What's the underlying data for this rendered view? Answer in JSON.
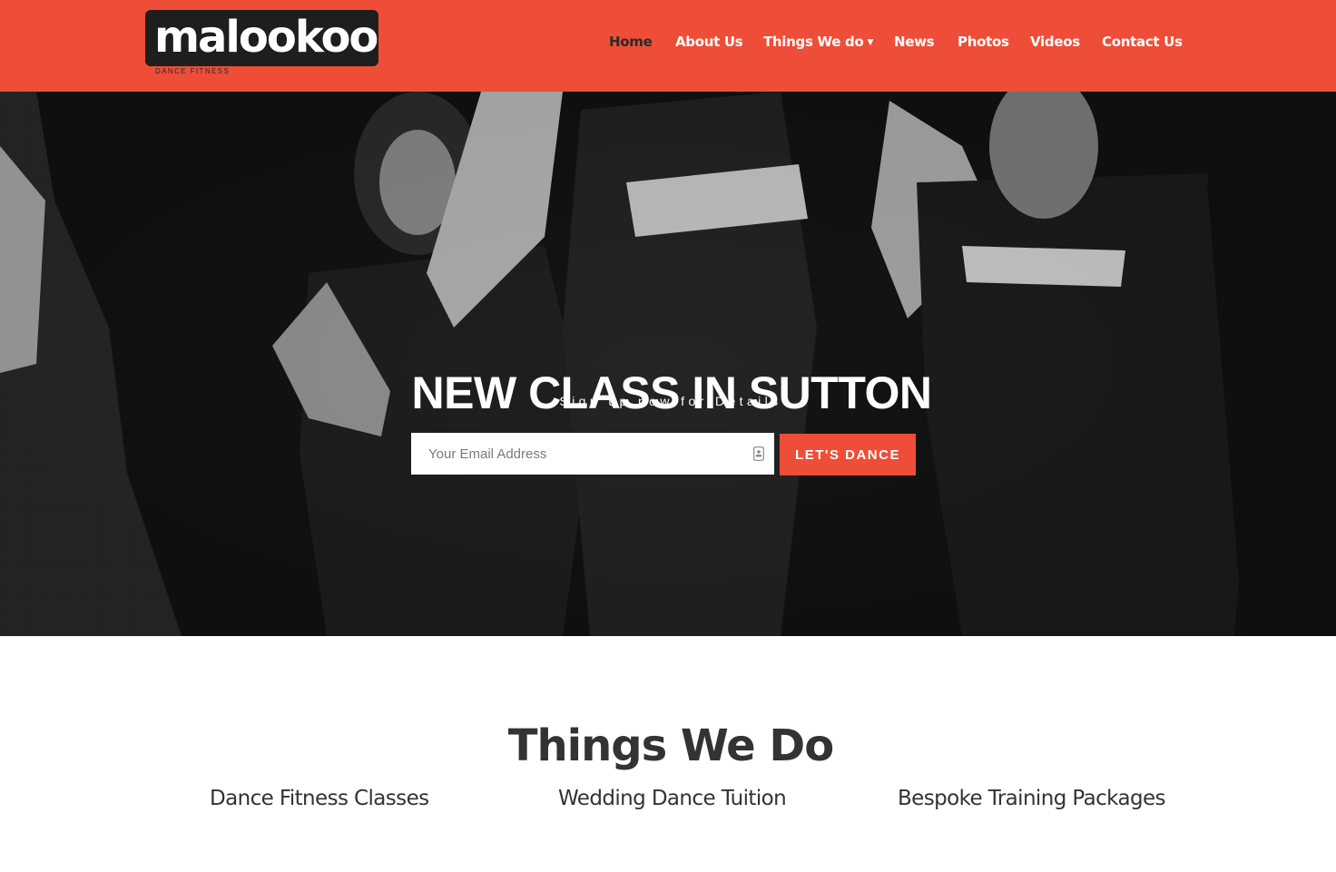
{
  "brand": {
    "logo_text": "malookoo",
    "tagline": "DANCE FITNESS"
  },
  "nav": {
    "items": [
      {
        "label": "Home",
        "active": true
      },
      {
        "label": "About Us"
      },
      {
        "label": "Things We do",
        "has_dropdown": true
      },
      {
        "label": "News"
      },
      {
        "label": "Photos"
      },
      {
        "label": "Videos"
      },
      {
        "label": "Contact Us"
      }
    ]
  },
  "hero": {
    "title": "NEW CLASS IN SUTTON",
    "subtitle": "Sign up now for Details",
    "email_placeholder": "Your Email Address",
    "button_label": "LET'S DANCE"
  },
  "services": {
    "title": "Things We Do",
    "items": [
      "Dance Fitness Classes",
      "Wedding Dance Tuition",
      "Bespoke Training Packages"
    ]
  },
  "colors": {
    "brand_red": "#ee4d37",
    "header_text": "#ffffff",
    "active_nav": "#2b2b2b",
    "body_text": "#333333"
  }
}
